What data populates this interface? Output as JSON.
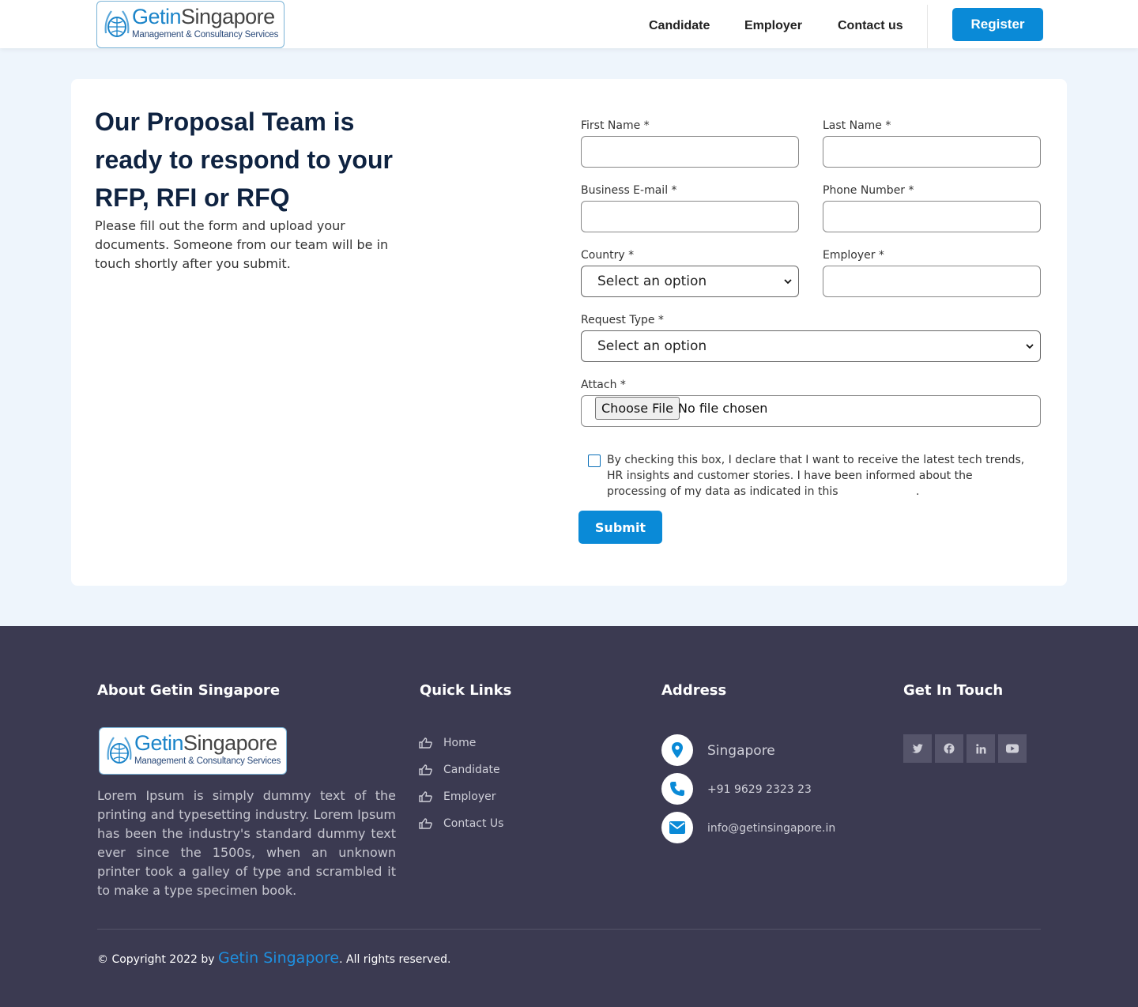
{
  "brand": {
    "name_part1": "Getin",
    "name_part2": "Singapore",
    "tagline": "Management & Consultancy Services"
  },
  "nav": {
    "items": [
      "Candidate",
      "Employer",
      "Contact us"
    ],
    "register_label": "Register"
  },
  "intro": {
    "heading": "Our Proposal Team is ready to respond to your RFP, RFI or RFQ",
    "body": "Please fill out the form and upload your documents. Someone from our team will be in touch shortly after you submit."
  },
  "form": {
    "first_name_label": "First Name *",
    "last_name_label": "Last Name *",
    "email_label": "Business E-mail *",
    "phone_label": "Phone Number *",
    "country_label": "Country *",
    "country_value": "Select an option",
    "employer_label": "Employer *",
    "request_type_label": "Request Type *",
    "request_type_value": "Select an option",
    "attach_label": "Attach *",
    "choose_file_label": "Choose File",
    "no_file_text": "No file chosen",
    "consent_text_before": "By checking this box, I declare that I want to receive the latest tech trends, HR insights and customer stories. I have been informed about the processing of my data as indicated in this",
    "consent_text_after": ".",
    "submit_label": "Submit"
  },
  "footer": {
    "about_heading": "About Getin Singapore",
    "about_text": "Lorem Ipsum is simply dummy text of the printing and typesetting industry. Lorem Ipsum has been the industry's standard dummy text ever since the 1500s, when an unknown printer took a galley of type and scrambled it to make a type specimen book.",
    "quick_links_heading": "Quick Links",
    "quick_links": [
      "Home",
      "Candidate",
      "Employer",
      "Contact Us"
    ],
    "address_heading": "Address",
    "address_location": "Singapore",
    "address_phone": "+91 9629 2323 23",
    "address_email": "info@getinsingapore.in",
    "get_in_touch_heading": "Get In Touch",
    "social_icons": [
      "twitter-icon",
      "facebook-icon",
      "linkedin-icon",
      "youtube-icon"
    ],
    "copyright_before": "© Copyright 2022 by",
    "copyright_brand": "Getin Singapore",
    "copyright_after": ". All rights reserved."
  },
  "colors": {
    "accent": "#0a8ad7",
    "page_bg": "#eef5fc",
    "footer_bg": "#3b3a51",
    "heading": "#0f2341"
  }
}
